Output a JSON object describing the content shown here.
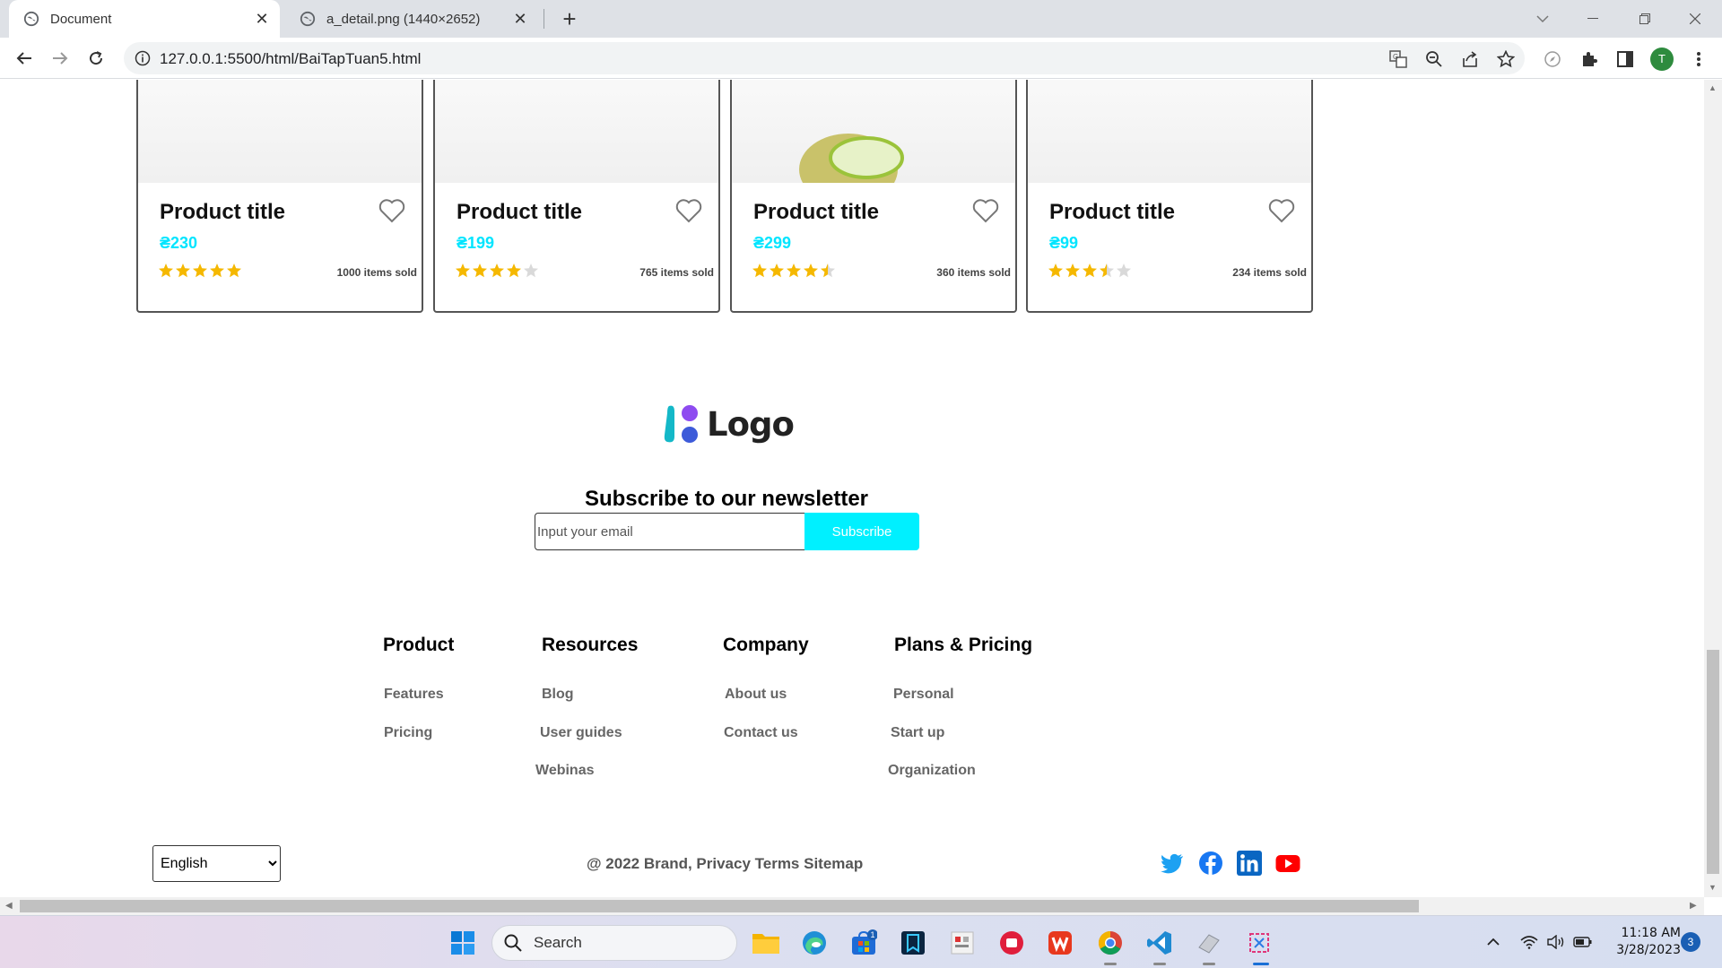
{
  "browser": {
    "tabs": [
      {
        "label": "Document",
        "active": true
      },
      {
        "label": "a_detail.png (1440×2652)",
        "active": false
      }
    ],
    "url": "127.0.0.1:5500/html/BaiTapTuan5.html",
    "profile_initial": "T"
  },
  "products": [
    {
      "title": "Product title",
      "price": "₴230",
      "rating": 5,
      "sold": "1000 items sold"
    },
    {
      "title": "Product title",
      "price": "₴199",
      "rating": 4,
      "sold": "765 items sold"
    },
    {
      "title": "Product title",
      "price": "₴299",
      "rating": 4.5,
      "sold": "360 items sold"
    },
    {
      "title": "Product title",
      "price": "₴99",
      "rating": 3.5,
      "sold": "234 items sold"
    }
  ],
  "footer": {
    "logo_text": "Logo",
    "newsletter_title": "Subscribe to our newsletter",
    "email_placeholder": "Input your email",
    "subscribe_label": "Subscribe",
    "columns": [
      {
        "heading": "Product",
        "links": [
          "Features",
          "Pricing"
        ]
      },
      {
        "heading": "Resources",
        "links": [
          "Blog",
          "User guides",
          "Webinas"
        ]
      },
      {
        "heading": "Company",
        "links": [
          "About us",
          "Contact us"
        ]
      },
      {
        "heading": "Plans & Pricing",
        "links": [
          "Personal",
          "Start up",
          "Organization"
        ]
      }
    ],
    "language": "English",
    "copyright": "@ 2022 Brand, Privacy Terms Sitemap",
    "social": [
      "twitter-icon",
      "facebook-icon",
      "linkedin-icon",
      "youtube-icon"
    ]
  },
  "taskbar": {
    "search_label": "Search",
    "time": "11:18 AM",
    "date": "3/28/2023",
    "notification_count": "3",
    "store_badge": "1"
  },
  "colors": {
    "accent": "#00f0ff",
    "star": "#f5b800",
    "star_empty": "#d9d9d9"
  }
}
